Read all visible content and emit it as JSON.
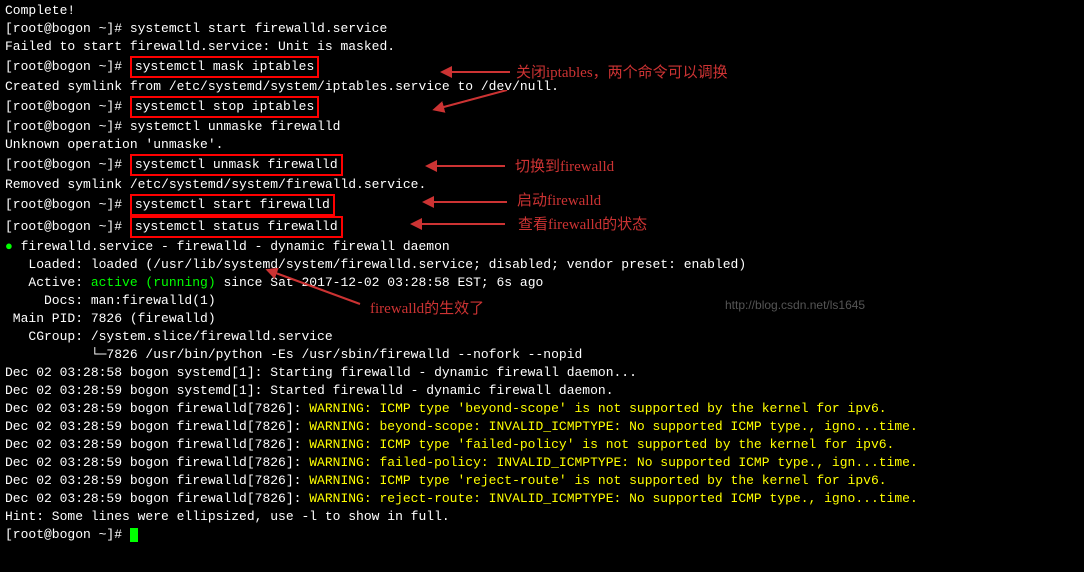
{
  "l1": "Complete!",
  "prompt": "[root@bogon ~]# ",
  "cmd1": "systemctl start firewalld.service",
  "l3": "Failed to start firewalld.service: Unit is masked.",
  "cmd2": "systemctl mask iptables",
  "l5": "Created symlink from /etc/systemd/system/iptables.service to /dev/null.",
  "cmd3": "systemctl stop iptables",
  "cmd4": "systemctl unmaske firewalld",
  "l8": "Unknown operation 'unmaske'.",
  "cmd5": "systemctl unmask firewalld",
  "l10": "Removed symlink /etc/systemd/system/firewalld.service.",
  "cmd6": "systemctl start firewalld",
  "cmd7": "systemctl status firewalld",
  "l13": "● firewalld.service - firewalld - dynamic firewall daemon",
  "l14": "   Loaded: loaded (/usr/lib/systemd/system/firewalld.service; disabled; vendor preset: enabled)",
  "l15a": "   Active: ",
  "l15b": "active (running)",
  "l15c": " since Sat 2017-12-02 03:28:58 EST; 6s ago",
  "l16": "     Docs: man:firewalld(1)",
  "l17": " Main PID: 7826 (firewalld)",
  "l18": "   CGroup: /system.slice/firewalld.service",
  "l19": "           └─7826 /usr/bin/python -Es /usr/sbin/firewalld --nofork --nopid",
  "l20": "",
  "l21a": "Dec 02 03:28:58 bogon systemd[1]: Starting firewalld - dynamic firewall daemon...",
  "l22a": "Dec 02 03:28:59 bogon systemd[1]: Started firewalld - dynamic firewall daemon.",
  "log_prefix": "Dec 02 03:28:59 bogon firewalld[7826]: ",
  "w1": "WARNING: ICMP type 'beyond-scope' is not supported by the kernel for ipv6.",
  "w2": "WARNING: beyond-scope: INVALID_ICMPTYPE: No supported ICMP type., igno...time.",
  "w3": "WARNING: ICMP type 'failed-policy' is not supported by the kernel for ipv6.",
  "w4": "WARNING: failed-policy: INVALID_ICMPTYPE: No supported ICMP type., ign...time.",
  "w5": "WARNING: ICMP type 'reject-route' is not supported by the kernel for ipv6.",
  "w6": "WARNING: reject-route: INVALID_ICMPTYPE: No supported ICMP type., igno...time.",
  "l29": "Hint: Some lines were ellipsized, use -l to show in full.",
  "ann1": "关闭iptables，两个命令可以调换",
  "ann2": "切换到firewalld",
  "ann3": "启动firewalld",
  "ann4": "查看firewalld的状态",
  "ann5": "firewalld的生效了",
  "wm": "http://blog.csdn.net/ls1645"
}
